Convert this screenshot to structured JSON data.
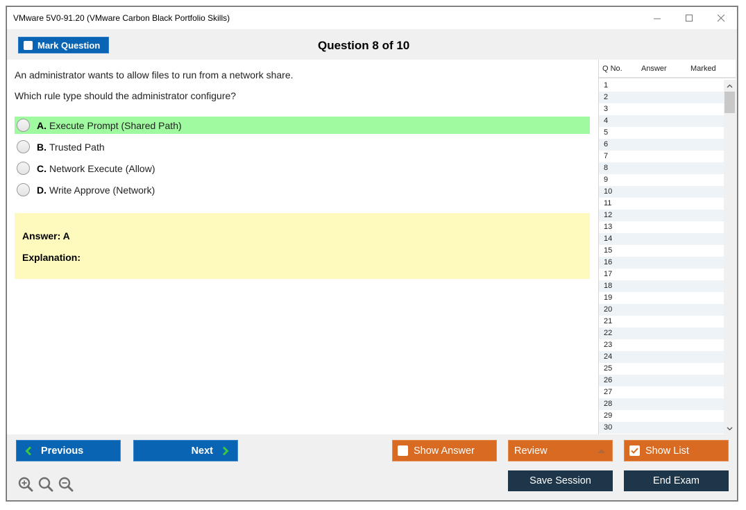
{
  "window": {
    "title": "VMware 5V0-91.20 (VMware Carbon Black Portfolio Skills)",
    "controls": [
      "minimize",
      "maximize",
      "close"
    ]
  },
  "topbar": {
    "mark_question_label": "Mark Question",
    "question_header": "Question 8 of 10"
  },
  "question": {
    "lines": [
      "An administrator wants to allow files to run from a network share.",
      "Which rule type should the administrator configure?"
    ],
    "options": [
      {
        "letter": "A.",
        "text": "Execute Prompt (Shared Path)",
        "correct": true
      },
      {
        "letter": "B.",
        "text": "Trusted Path",
        "correct": false
      },
      {
        "letter": "C.",
        "text": "Network Execute (Allow)",
        "correct": false
      },
      {
        "letter": "D.",
        "text": "Write Approve (Network)",
        "correct": false
      }
    ],
    "answer_label": "Answer: A",
    "explanation_label": "Explanation:"
  },
  "question_list": {
    "headers": {
      "qno": "Q No.",
      "answer": "Answer",
      "marked": "Marked"
    },
    "rows": [
      "1",
      "2",
      "3",
      "4",
      "5",
      "6",
      "7",
      "8",
      "9",
      "10",
      "11",
      "12",
      "13",
      "14",
      "15",
      "16",
      "17",
      "18",
      "19",
      "20",
      "21",
      "22",
      "23",
      "24",
      "25",
      "26",
      "27",
      "28",
      "29",
      "30"
    ]
  },
  "footer": {
    "previous_label": "Previous",
    "next_label": "Next",
    "show_answer_label": "Show Answer",
    "show_answer_checked": false,
    "review_label": "Review",
    "show_list_label": "Show List",
    "show_list_checked": true,
    "save_session_label": "Save Session",
    "end_exam_label": "End Exam",
    "zoom_icons": [
      "zoom-in-icon",
      "zoom-reset-icon",
      "zoom-out-icon"
    ]
  },
  "colors": {
    "primary_blue": "#0a64b4",
    "orange": "#d86a21",
    "navy": "#1d3649",
    "correct_highlight": "#a0fba0",
    "answer_box": "#fef9bc",
    "chevron_green": "#3cc83c"
  }
}
